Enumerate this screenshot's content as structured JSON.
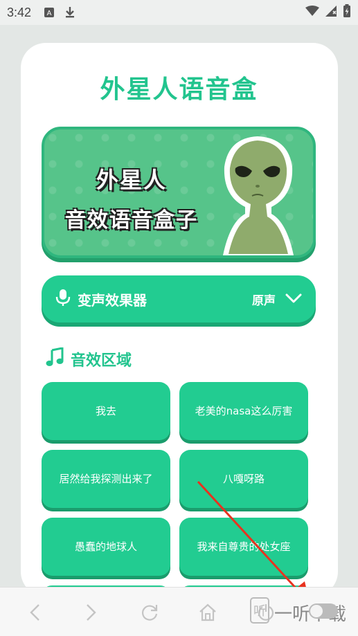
{
  "status_bar": {
    "time": "3:42"
  },
  "page": {
    "title": "外星人语音盒"
  },
  "banner": {
    "line1": "外星人",
    "line2": "音效语音盒子"
  },
  "voice_changer": {
    "label": "变声效果器",
    "selected": "原声"
  },
  "sound_section": {
    "title": "音效区域",
    "sounds": [
      "我去",
      "老美的nasa这么厉害",
      "居然给我探测出来了",
      "八嘎呀路",
      "愚蠢的地球人",
      "我来自尊贵的处女座"
    ]
  },
  "watermark": {
    "text": "一听下载"
  },
  "colors": {
    "accent": "#22cc91",
    "title": "#22c48e",
    "annotation": "#e8321f"
  }
}
